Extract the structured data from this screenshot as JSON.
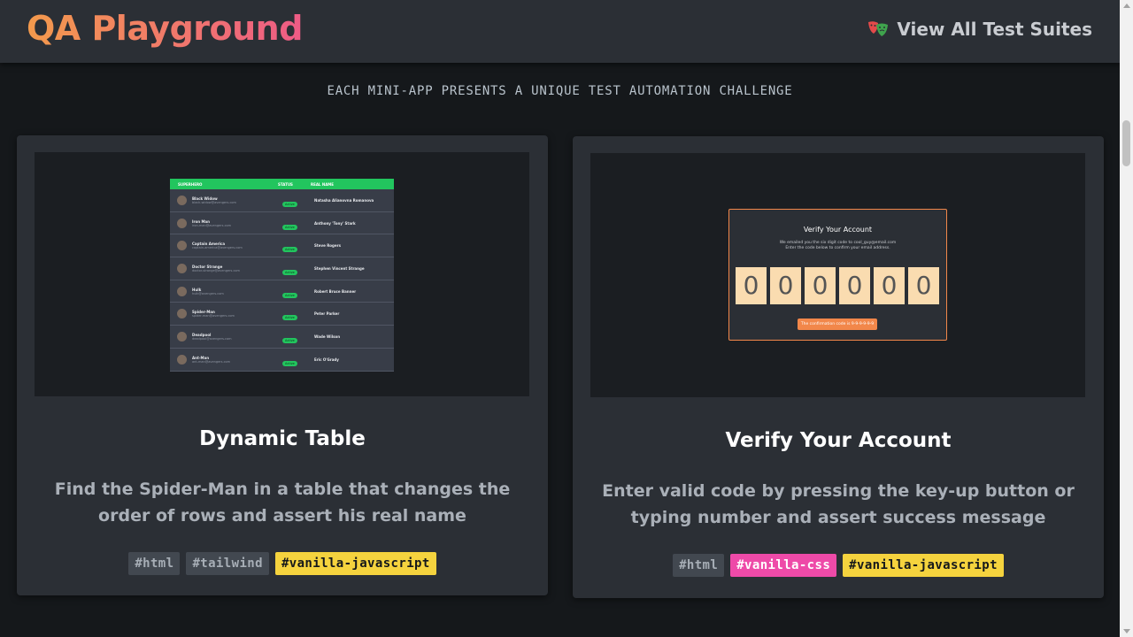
{
  "header": {
    "logo": "QA Playground",
    "nav_link": "View All Test Suites",
    "nav_icon": "theater-masks-icon"
  },
  "tagline": "EACH MINI-APP PRESENTS A UNIQUE TEST AUTOMATION CHALLENGE",
  "cards": [
    {
      "title": "Dynamic Table",
      "description": "Find the Spider-Man in a table that changes the order of rows and assert his real name",
      "tags": [
        "#html",
        "#tailwind",
        "#vanilla-javascript"
      ],
      "preview": {
        "headers": [
          "SUPERHERO",
          "STATUS",
          "REAL NAME"
        ],
        "rows": [
          {
            "hero": "Black Widow",
            "email": "black-widow@avengers.com",
            "status": "Active",
            "real": "Natasha Alianovna Romanova"
          },
          {
            "hero": "Iron Man",
            "email": "iron-man@avengers.com",
            "status": "Active",
            "real": "Anthony 'Tony' Stark"
          },
          {
            "hero": "Captain America",
            "email": "captain-america@avengers.com",
            "status": "Active",
            "real": "Steve Rogers"
          },
          {
            "hero": "Doctor Strange",
            "email": "doctor-strange@avengers.com",
            "status": "Active",
            "real": "Stephen Vincent Strange"
          },
          {
            "hero": "Hulk",
            "email": "hulk@avengers.com",
            "status": "Active",
            "real": "Robert Bruce Banner"
          },
          {
            "hero": "Spider-Man",
            "email": "spider-man@avengers.com",
            "status": "Active",
            "real": "Peter Parker"
          },
          {
            "hero": "Deadpool",
            "email": "deadpool@avengers.com",
            "status": "Active",
            "real": "Wade Wilson"
          },
          {
            "hero": "Ant-Man",
            "email": "ant-man@avengers.com",
            "status": "Active",
            "real": "Eric O'Grady"
          }
        ]
      }
    },
    {
      "title": "Verify Your Account",
      "description": "Enter valid code by pressing the key-up button or typing number and assert success message",
      "tags": [
        "#html",
        "#vanilla-css",
        "#vanilla-javascript"
      ],
      "preview": {
        "title": "Verify Your Account",
        "line1": "We emailed you the six digit code to cool_guy@email.com",
        "line2": "Enter the code below to confirm your email address.",
        "digits": [
          "0",
          "0",
          "0",
          "0",
          "0",
          "0"
        ],
        "button": "The confirmation code is 9-9-9-9-9-9"
      }
    }
  ],
  "colors": {
    "background": "#15181b",
    "card": "#2b2f35",
    "accent_orange": "#f39a4c",
    "accent_pink": "#ee5b86",
    "tag_yellow": "#f5d33e",
    "tag_pink": "#ee4aa8"
  }
}
